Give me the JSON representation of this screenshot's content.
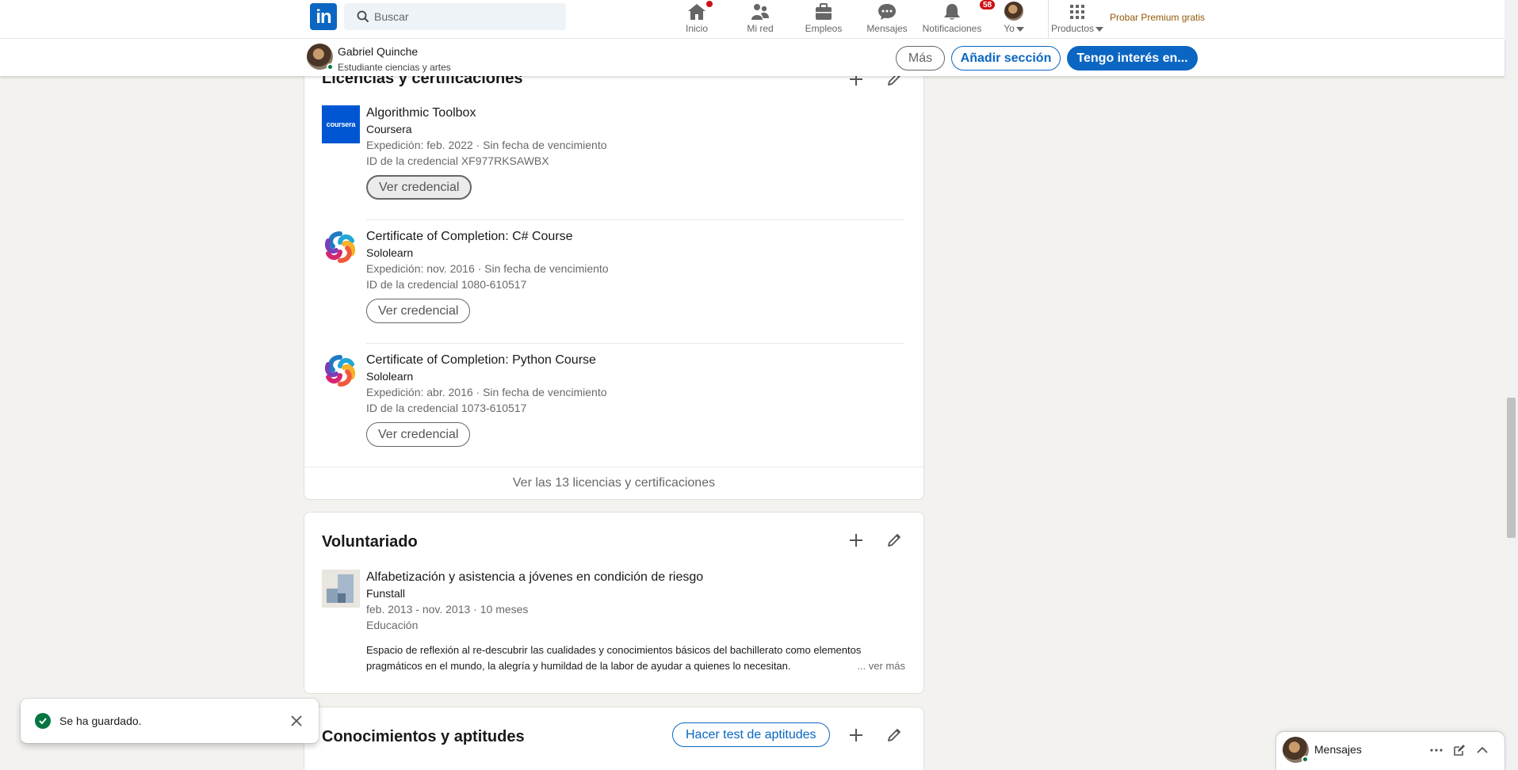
{
  "nav": {
    "logo_text": "in",
    "search_placeholder": "Buscar",
    "items": [
      {
        "label": "Inicio",
        "icon": "home-icon"
      },
      {
        "label": "Mi red",
        "icon": "people-icon"
      },
      {
        "label": "Empleos",
        "icon": "briefcase-icon"
      },
      {
        "label": "Mensajes",
        "icon": "chat-icon"
      },
      {
        "label": "Notificaciones",
        "icon": "bell-icon",
        "badge": "58"
      },
      {
        "label": "Yo",
        "icon": "avatar"
      },
      {
        "label": "Productos",
        "icon": "grid-icon"
      }
    ],
    "premium_label": "Probar Premium gratis"
  },
  "profile_bar": {
    "name": "Gabriel Quinche",
    "headline": "Estudiante ciencias y artes",
    "more_label": "Más",
    "add_section_label": "Añadir sección",
    "open_to_label": "Tengo interés en..."
  },
  "licenses": {
    "title": "Licencias y certificaciones",
    "items": [
      {
        "logo": "coursera-logo",
        "logo_text": "coursera",
        "name": "Algorithmic Toolbox",
        "issuer": "Coursera",
        "issued": "Expedición: feb. 2022 · Sin fecha de vencimiento",
        "credential_id": "ID de la credencial XF977RKSAWBX",
        "button": "Ver credencial"
      },
      {
        "logo": "sololearn-logo",
        "name": "Certificate of Completion: C# Course",
        "issuer": "Sololearn",
        "issued": "Expedición: nov. 2016 · Sin fecha de vencimiento",
        "credential_id": "ID de la credencial 1080-610517",
        "button": "Ver credencial"
      },
      {
        "logo": "sololearn-logo",
        "name": "Certificate of Completion: Python Course",
        "issuer": "Sololearn",
        "issued": "Expedición: abr. 2016 · Sin fecha de vencimiento",
        "credential_id": "ID de la credencial 1073-610517",
        "button": "Ver credencial"
      }
    ],
    "show_all": "Ver las 13 licencias y certificaciones"
  },
  "volunteer": {
    "title": "Voluntariado",
    "item": {
      "role": "Alfabetización y asistencia a jóvenes en condición de riesgo",
      "org": "Funstall",
      "dates": "feb. 2013 - nov. 2013 · 10 meses",
      "cause": "Educación",
      "description_line1": "Espacio de reflexión al re-descubrir las cualidades y conocimientos básicos del bachillerato como elementos",
      "description_line2": "pragmáticos en el mundo, la alegría y humildad de la labor de ayudar a quienes lo necesitan.",
      "see_more": "... ver más"
    }
  },
  "skills": {
    "title": "Conocimientos y aptitudes",
    "test_button": "Hacer test de aptitudes"
  },
  "toast": {
    "message": "Se ha guardado."
  },
  "messaging": {
    "label": "Mensajes"
  },
  "colors": {
    "brand": "#0a66c2",
    "success": "#057642",
    "badge": "#cc1016",
    "premium": "#915907",
    "background": "#f3f2ef"
  }
}
